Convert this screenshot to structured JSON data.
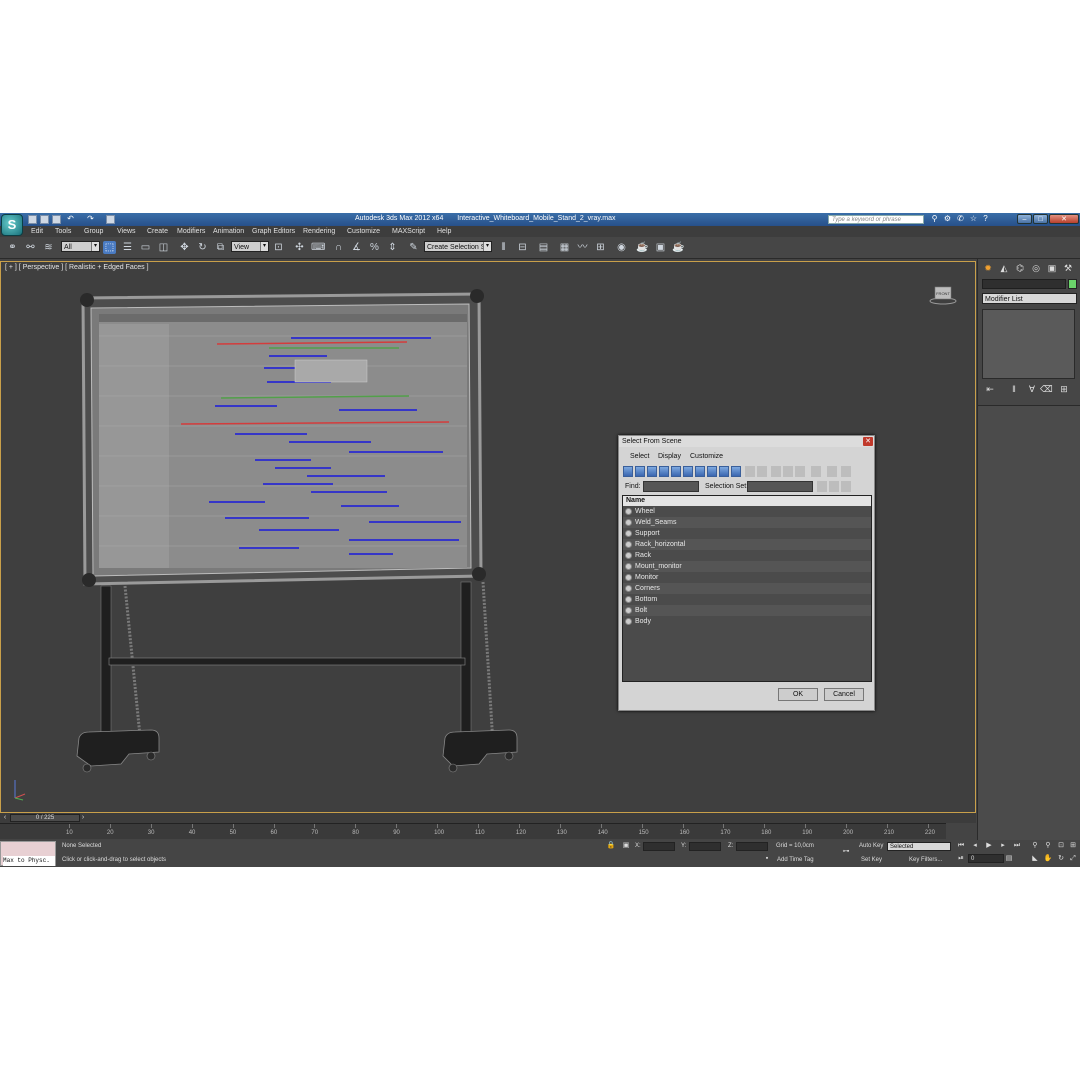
{
  "titlebar": {
    "app_name": "Autodesk 3ds Max  2012 x64",
    "file_name": "Interactive_Whiteboard_Mobile_Stand_2_vray.max",
    "search_placeholder": "Type a keyword or phrase"
  },
  "menubar": [
    "Edit",
    "Tools",
    "Group",
    "Views",
    "Create",
    "Modifiers",
    "Animation",
    "Graph Editors",
    "Rendering",
    "Customize",
    "MAXScript",
    "Help"
  ],
  "toolbar": {
    "selection_filter": "All",
    "ref_coord": "View",
    "named_selection": "Create Selection Se"
  },
  "viewport": {
    "label": "[ + ] [ Perspective ] [ Realistic + Edged Faces ]",
    "viewcube_label": "FRONT"
  },
  "command_panel": {
    "modifier_list": "Modifier List"
  },
  "dialog": {
    "title": "Select From Scene",
    "menu": [
      "Select",
      "Display",
      "Customize"
    ],
    "find_label": "Find:",
    "selection_set_label": "Selection Set:",
    "column_name": "Name",
    "items": [
      "Wheel",
      "Weld_Seams",
      "Support",
      "Rack_horizontal",
      "Rack",
      "Mount_monitor",
      "Monitor",
      "Corners",
      "Bottom",
      "Bolt",
      "Body"
    ],
    "ok_label": "OK",
    "cancel_label": "Cancel"
  },
  "timeline": {
    "frame_readout": "0 / 225",
    "ticks": [
      "10",
      "20",
      "30",
      "40",
      "50",
      "60",
      "70",
      "80",
      "90",
      "100",
      "110",
      "120",
      "130",
      "140",
      "150",
      "160",
      "170",
      "180",
      "190",
      "200",
      "210",
      "220"
    ]
  },
  "status": {
    "maxscript": "Max to Physc.",
    "selection": "None Selected",
    "prompt": "Click or click-and-drag to select objects",
    "x_label": "X:",
    "y_label": "Y:",
    "z_label": "Z:",
    "grid": "Grid = 10,0cm",
    "add_time_tag": "Add Time Tag",
    "auto_key": "Auto Key",
    "set_key": "Set Key",
    "key_mode": "Selected",
    "key_filters": "Key Filters...",
    "frame_value": "0"
  }
}
